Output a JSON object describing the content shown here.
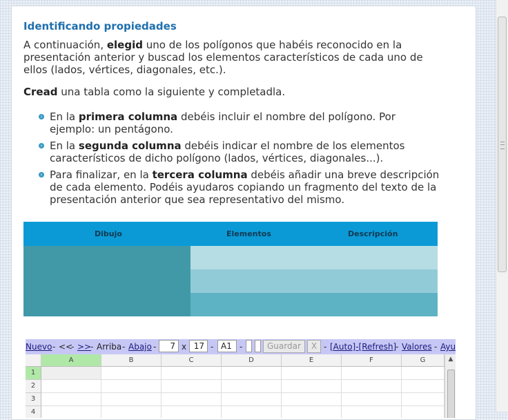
{
  "section": {
    "title": "Identificando propiedades",
    "p1_a": "A continuación, ",
    "p1_b": "elegid",
    "p1_c": " uno de los polígonos que habéis reconocido en la presentación anterior y buscad los elementos característicos de cada uno de ellos (lados, vértices, diagonales, etc.).",
    "p2_a": "Cread",
    "p2_b": " una tabla como la siguiente y completadla."
  },
  "bullets": [
    {
      "a": "En la ",
      "b": "primera columna",
      "c": " debéis incluir el nombre del polígono. Por ejemplo: un pentágono."
    },
    {
      "a": "En la ",
      "b": "segunda columna",
      "c": " debéis indicar el nombre de los elementos característicos de dicho polígono (lados, vértices, diagonales...)."
    },
    {
      "a": "Para finalizar, en la ",
      "b": "tercera columna",
      "c": " debéis añadir  una breve descripción de cada elemento. Podéis ayudaros copiando un fragmento del texto de la presentación anterior que sea representativo del mismo."
    }
  ],
  "table": {
    "col1": "Dibujo",
    "col2": "Elementos",
    "col3": "Descripción"
  },
  "spreadsheet": {
    "toolbar": {
      "nuevo": "Nuevo",
      "sep1": "-",
      "prev": "<<",
      "sep2": "-",
      "next": ">>",
      "sep3": "-",
      "arriba": "Arriba",
      "sep4": "-",
      "abajo": "Abajo",
      "sep5": "-",
      "rows_value": "7",
      "x_label": "x",
      "cols_value": "17",
      "sep6": "-",
      "cell_ref": "A1",
      "sep7": "-",
      "guardar": "Guardar",
      "close_x": "X",
      "sep8": "-",
      "auto_refresh": "[Auto]-[Refresh]",
      "sep9": "-",
      "valores": "Valores",
      "sep10": "-",
      "ayuda": "Ayu"
    },
    "columns": [
      "A",
      "B",
      "C",
      "D",
      "E",
      "F",
      "G"
    ],
    "rows": [
      "1",
      "2",
      "3",
      "4"
    ],
    "scroll_up": "▲"
  },
  "colors": {
    "accent": "#1f6fae",
    "table_header": "#0b9ad6",
    "toolbar_bg": "#c7c7f6"
  }
}
